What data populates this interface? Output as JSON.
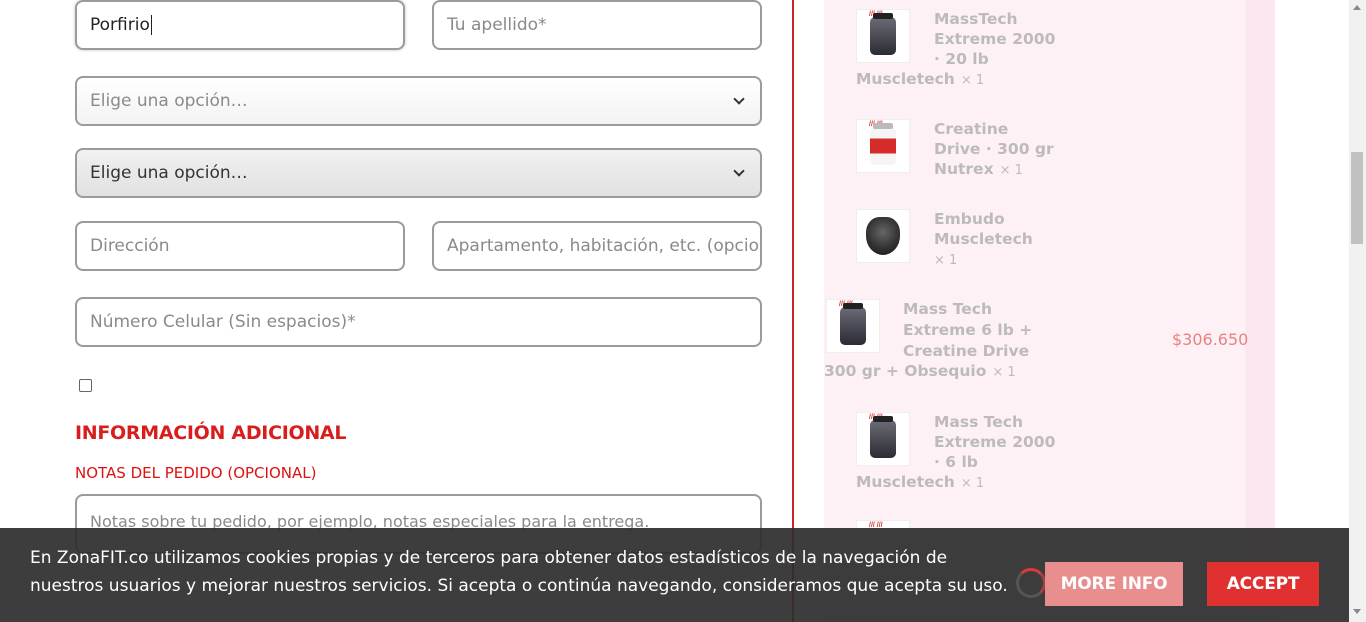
{
  "form": {
    "first_name_value": "Porfirio",
    "last_name_placeholder": "Tu apellido*",
    "select_1_value": "Elige una opción…",
    "select_2_value": "Elige una opción…",
    "address_placeholder": "Dirección",
    "apartment_placeholder": "Apartamento, habitación, etc. (opcional)",
    "phone_placeholder": "Número Celular (Sin espacios)*",
    "checkbox_checked": false,
    "additional_info_heading": "INFORMACIÓN ADICIONAL",
    "order_notes_label": "NOTAS DEL PEDIDO (OPCIONAL)",
    "order_notes_placeholder": "Notas sobre tu pedido, por ejemplo, notas especiales para la entrega."
  },
  "order_summary": {
    "items": [
      {
        "name_lines": [
          "MassTech",
          "Extreme 2000",
          "· 20 lb"
        ],
        "last_line": "Muscletech",
        "qty": "× 1",
        "icon": "supplement-jar-icon"
      },
      {
        "name_lines": [
          "Creatine",
          "Drive · 300 gr"
        ],
        "last_line": "Nutrex",
        "qty": "× 1",
        "icon": "creatine-jar-icon"
      },
      {
        "name_lines": [
          "Embudo",
          "Muscletech"
        ],
        "last_line": "",
        "qty": "× 1",
        "icon": "funnel-icon"
      },
      {
        "name_lines": [
          "Mass Tech",
          "Extreme 6 lb +",
          "Creatine Drive"
        ],
        "last_line": "300 gr + Obsequio",
        "qty": "× 1",
        "icon": "combo-pack-icon",
        "price": "$306.650"
      },
      {
        "name_lines": [
          "Mass Tech",
          "Extreme 2000",
          "· 6 lb"
        ],
        "last_line": "Muscletech",
        "qty": "× 1",
        "icon": "supplement-jar-icon"
      }
    ]
  },
  "cookie_banner": {
    "text": "En ZonaFIT.co utilizamos cookies propias y de terceros para obtener datos estadísticos de la navegación de nuestros usuarios y mejorar nuestros servicios. Si acepta o continúa navegando, consideramos que acepta su uso.",
    "more_info_label": "MORE INFO",
    "accept_label": "ACCEPT"
  },
  "colors": {
    "accent_red": "#d91d1d",
    "accept_button": "#e03030",
    "more_info_button": "#e98e8e",
    "summary_background": "#fbe7f0"
  }
}
